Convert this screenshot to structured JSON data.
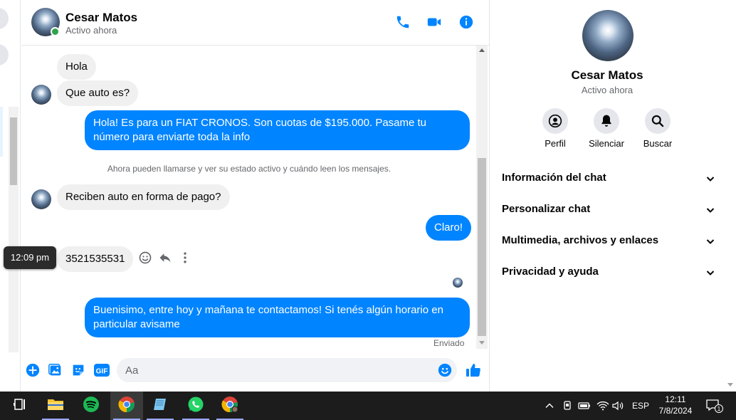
{
  "header": {
    "name": "Cesar Matos",
    "status": "Activo ahora"
  },
  "messages": [
    {
      "dir": "in",
      "text": "Hola"
    },
    {
      "dir": "in",
      "text": "Que auto es?"
    },
    {
      "dir": "out",
      "text": "Hola! Es para un FIAT CRONOS. Son cuotas de $195.000. Pasame tu número para enviarte toda la info"
    },
    {
      "dir": "in",
      "text": "Reciben auto en forma de pago?"
    },
    {
      "dir": "out",
      "text": "Claro!"
    },
    {
      "dir": "in",
      "text": "3521535531"
    },
    {
      "dir": "out",
      "text": "Buenisimo, entre hoy y mañana te contactamos! Si tenés algún horario en particular avisame"
    }
  ],
  "system_note": "Ahora pueden llamarse y ver su estado activo y cuándo leen los mensajes.",
  "tooltip_time": "12:09 pm",
  "sent_label": "Enviado",
  "composer": {
    "placeholder": "Aa",
    "gif_label": "GIF"
  },
  "info_panel": {
    "name": "Cesar Matos",
    "status": "Activo ahora",
    "actions": [
      {
        "label": "Perfil",
        "icon": "profile-icon"
      },
      {
        "label": "Silenciar",
        "icon": "bell-icon"
      },
      {
        "label": "Buscar",
        "icon": "search-icon"
      }
    ],
    "sections": [
      "Información del chat",
      "Personalizar chat",
      "Multimedia, archivos y enlaces",
      "Privacidad y ayuda"
    ]
  },
  "taskbar": {
    "language": "ESP",
    "time": "12:11",
    "date": "7/8/2024",
    "notifications": "1"
  },
  "colors": {
    "accent": "#0084ff",
    "incoming_bubble": "#f0f0f0",
    "online": "#31a24c"
  }
}
